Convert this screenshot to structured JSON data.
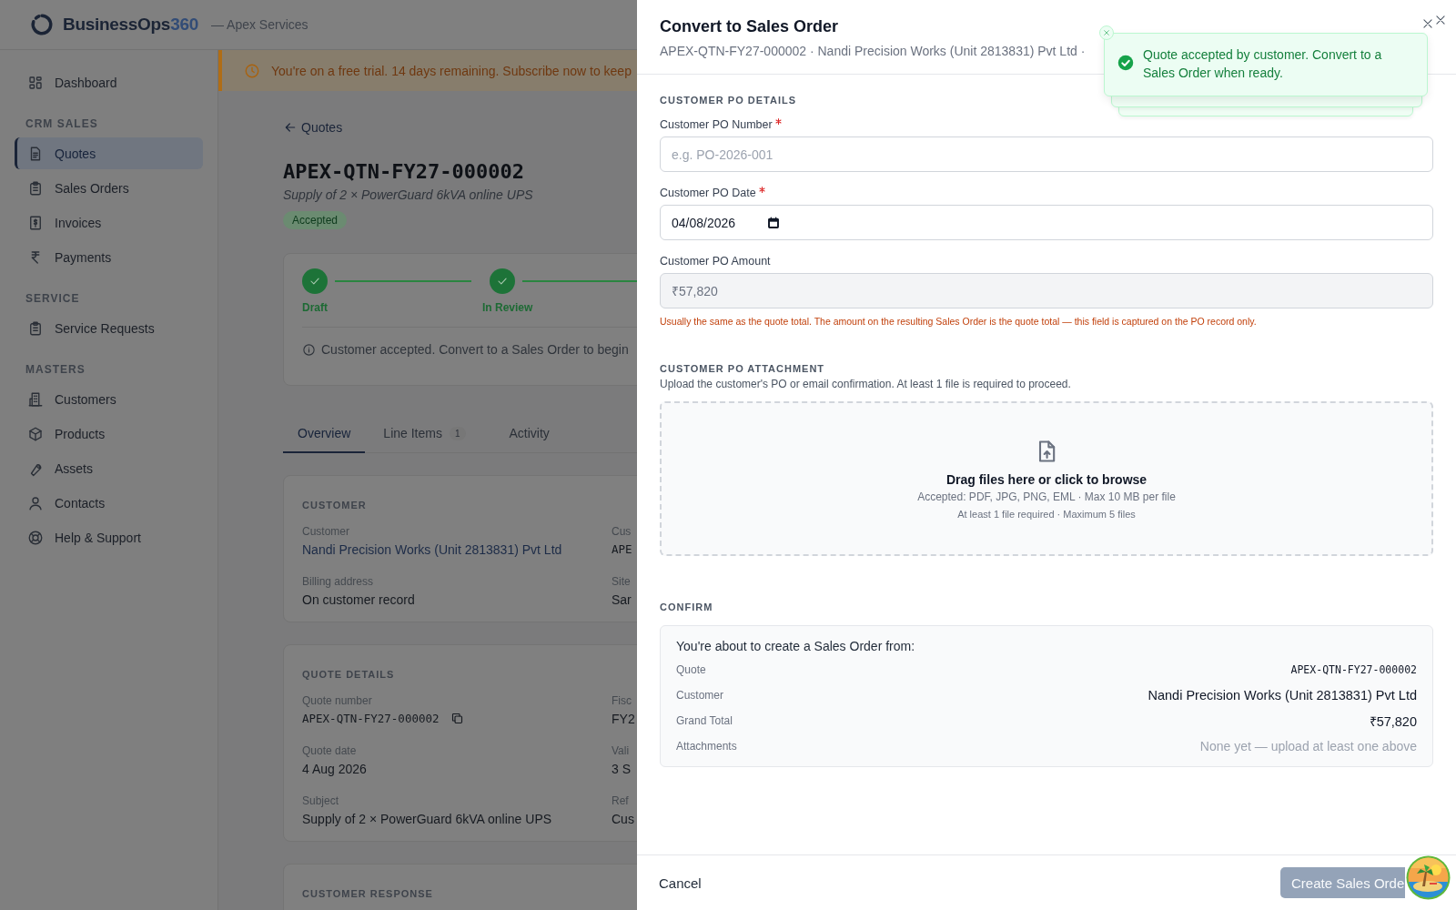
{
  "header": {
    "brand": "BusinessOps",
    "brand_accent": "360",
    "org": "— Apex Services"
  },
  "sidebar": {
    "items": [
      {
        "kind": "link",
        "label": "Dashboard",
        "selected": false
      },
      {
        "kind": "heading",
        "label": "CRM SALES"
      },
      {
        "kind": "link",
        "label": "Quotes",
        "selected": true
      },
      {
        "kind": "link",
        "label": "Sales Orders",
        "selected": false
      },
      {
        "kind": "link",
        "label": "Invoices",
        "selected": false
      },
      {
        "kind": "link",
        "label": "Payments",
        "selected": false
      },
      {
        "kind": "heading",
        "label": "SERVICE"
      },
      {
        "kind": "link",
        "label": "Service Requests",
        "selected": false
      },
      {
        "kind": "heading",
        "label": "MASTERS"
      },
      {
        "kind": "link",
        "label": "Customers",
        "selected": false
      },
      {
        "kind": "link",
        "label": "Products",
        "selected": false
      },
      {
        "kind": "link",
        "label": "Assets",
        "selected": false
      },
      {
        "kind": "link",
        "label": "Contacts",
        "selected": false
      },
      {
        "kind": "link",
        "label": "Help & Support",
        "selected": false
      }
    ]
  },
  "trial_banner": {
    "text": "You're on a free trial. 14 days remaining. Subscribe now to keep"
  },
  "quote": {
    "back_link": "Quotes",
    "number": "APEX-QTN-FY27-000002",
    "subject": "Supply of 2 × PowerGuard 6kVA online UPS",
    "status": "Accepted",
    "steps": [
      {
        "label": "Draft",
        "done": true
      },
      {
        "label": "In Review",
        "done": true
      }
    ],
    "info": "Customer accepted. Convert to a Sales Order to begin",
    "tabs": [
      {
        "label": "Overview",
        "selected": true
      },
      {
        "label": "Line Items",
        "count": "1",
        "selected": false
      },
      {
        "label": "Activity",
        "selected": false
      }
    ],
    "sections": [
      {
        "title": "CUSTOMER",
        "fields": [
          {
            "label": "Customer",
            "value": "Nandi Precision Works (Unit 2813831) Pvt Ltd",
            "kind": "link"
          },
          {
            "label": "Cus",
            "value": "APE",
            "kind": "mono"
          },
          {
            "label": "Billing address",
            "value": "On customer record",
            "kind": "text"
          },
          {
            "label": "Site",
            "value": "Sar",
            "kind": "text"
          }
        ]
      },
      {
        "title": "QUOTE DETAILS",
        "fields": [
          {
            "label": "Quote number",
            "value": "APEX-QTN-FY27-000002",
            "kind": "copy"
          },
          {
            "label": "Fisc",
            "value": "FY2",
            "kind": "text"
          },
          {
            "label": "Quote date",
            "value": "4 Aug 2026",
            "kind": "text"
          },
          {
            "label": "Vali",
            "value": "3 S",
            "kind": "text"
          },
          {
            "label": "Subject",
            "value": "Supply of 2 × PowerGuard 6kVA online UPS",
            "kind": "text"
          },
          {
            "label": "Ref",
            "value": "Cus",
            "kind": "text"
          }
        ]
      },
      {
        "title": "CUSTOMER RESPONSE"
      }
    ]
  },
  "drawer": {
    "title": "Convert to Sales Order",
    "subtitle": "APEX-QTN-FY27-000002 · Nandi Precision Works (Unit 2813831) Pvt Ltd ·",
    "po_section": "CUSTOMER PO DETAILS",
    "fields": [
      {
        "kind": "text",
        "label": "Customer PO Number",
        "required": true,
        "placeholder": "e.g. PO-2026-001",
        "disabled": false
      },
      {
        "kind": "date",
        "label": "Customer PO Date",
        "required": true,
        "value": "04/08/2026",
        "disabled": false
      },
      {
        "kind": "text",
        "label": "Customer PO Amount",
        "required": false,
        "value": "₹57,820",
        "disabled": true,
        "hint": "Usually the same as the quote total. The amount on the resulting Sales Order is the quote total — this field is captured on the PO record only."
      }
    ],
    "attachment": {
      "title": "CUSTOMER PO ATTACHMENT",
      "description": "Upload the customer's PO or email confirmation. At least 1 file is required to proceed.",
      "drop_title": "Drag files here or click to browse",
      "drop_accepted": "Accepted: PDF, JPG, PNG, EML · Max 10 MB per file",
      "drop_limits": "At least 1 file required · Maximum 5 files"
    },
    "confirm": {
      "title": "CONFIRM",
      "intro": "You're about to create a Sales Order from:",
      "rows": [
        {
          "label": "Quote",
          "value": "APEX-QTN-FY27-000002",
          "kind": "mono"
        },
        {
          "label": "Customer",
          "value": "Nandi Precision Works (Unit 2813831) Pvt Ltd",
          "kind": "strong"
        },
        {
          "label": "Grand Total",
          "value": "₹57,820",
          "kind": "strong"
        },
        {
          "label": "Attachments",
          "value": "None yet — upload at least one above",
          "kind": "muted"
        }
      ]
    },
    "cancel": "Cancel",
    "submit": "Create Sales Orde",
    "submit_disabled": true
  },
  "toast": {
    "kind": "success",
    "message": "Quote accepted by customer. Convert to a Sales Order when ready."
  }
}
